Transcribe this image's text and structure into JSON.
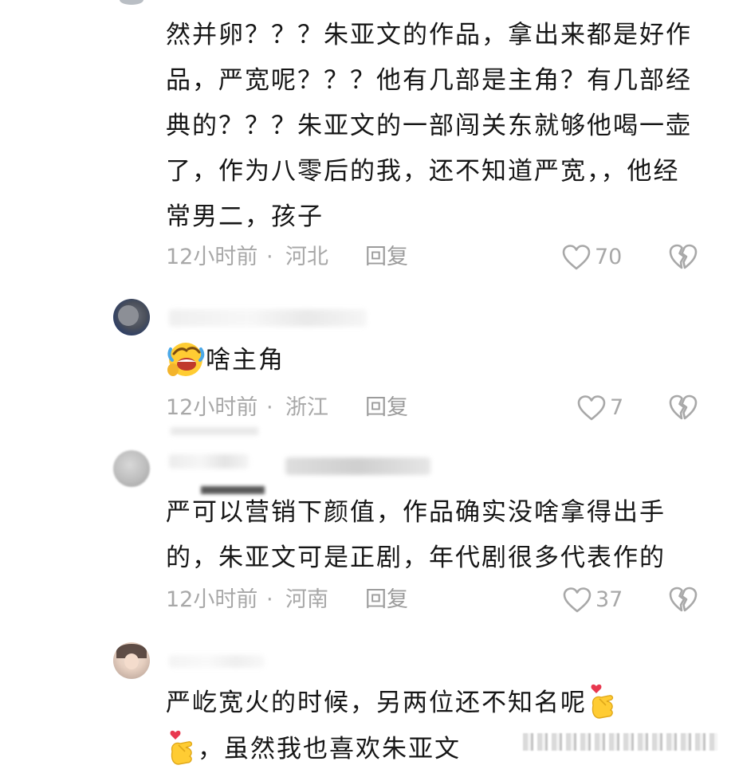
{
  "comments": [
    {
      "text": "然并卵？？？朱亚文的作品，拿出来都是好作品，严宽呢？？？他有几部是主角？有几部经典的？？？朱亚文的一部闯关东就够他喝一壶了，作为八零后的我，还不知道严宽，，他经常男二，孩子",
      "time": "12小时前",
      "dot": "·",
      "region": "河北",
      "reply": "回复",
      "likes": "70"
    },
    {
      "emoji": "laughing-crying-emoji",
      "text": "啥主角",
      "time": "12小时前",
      "dot": "·",
      "region": "浙江",
      "reply": "回复",
      "likes": "7"
    },
    {
      "text": "严可以营销下颜值，作品确实没啥拿得出手的，朱亚文可是正剧，年代剧很多代表作的",
      "time": "12小时前",
      "dot": "·",
      "region": "河南",
      "reply": "回复",
      "likes": "37"
    },
    {
      "text_part1": "严屹宽火的时候，另两位还不知名呢",
      "emoji": "finger-heart-emoji",
      "text_part2": "，虽然我也喜欢朱亚文"
    }
  ],
  "icons": {
    "like": "heart-outline-icon",
    "dislike": "broken-heart-icon",
    "colors": {
      "icon_gray": "#a8a8a8",
      "meta_gray": "#a8a8a8",
      "text": "#161616"
    }
  }
}
